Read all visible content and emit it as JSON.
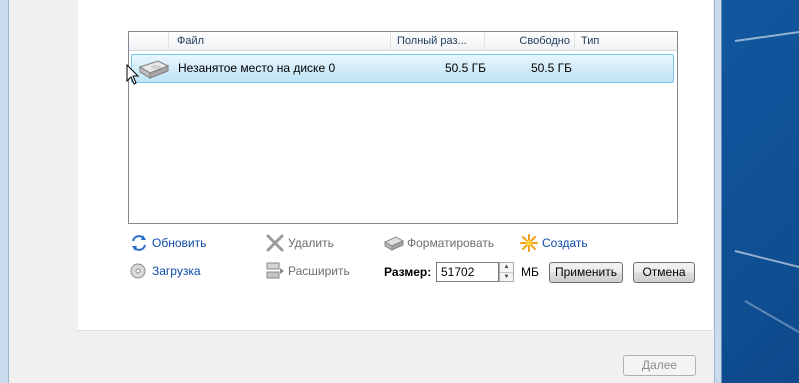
{
  "list": {
    "columns": [
      "Файл",
      "Полный раз...",
      "Свободно",
      "Тип"
    ],
    "rows": [
      {
        "name": "Незанятое место на диске 0",
        "size": "50.5 ГБ",
        "free": "50.5 ГБ",
        "type": ""
      }
    ]
  },
  "actions": {
    "refresh": "Обновить",
    "delete": "Удалить",
    "format": "Форматировать",
    "create": "Создать",
    "load": "Загрузка",
    "extend": "Расширить"
  },
  "size_field": {
    "label": "Размер:",
    "value": "51702",
    "unit": "МБ"
  },
  "buttons": {
    "apply": "Применить",
    "cancel": "Отмена",
    "next": "Далее"
  },
  "colors": {
    "link": "#0b4aa8",
    "selection": "#bfe3f7",
    "desktop": "#1e6bb5"
  }
}
